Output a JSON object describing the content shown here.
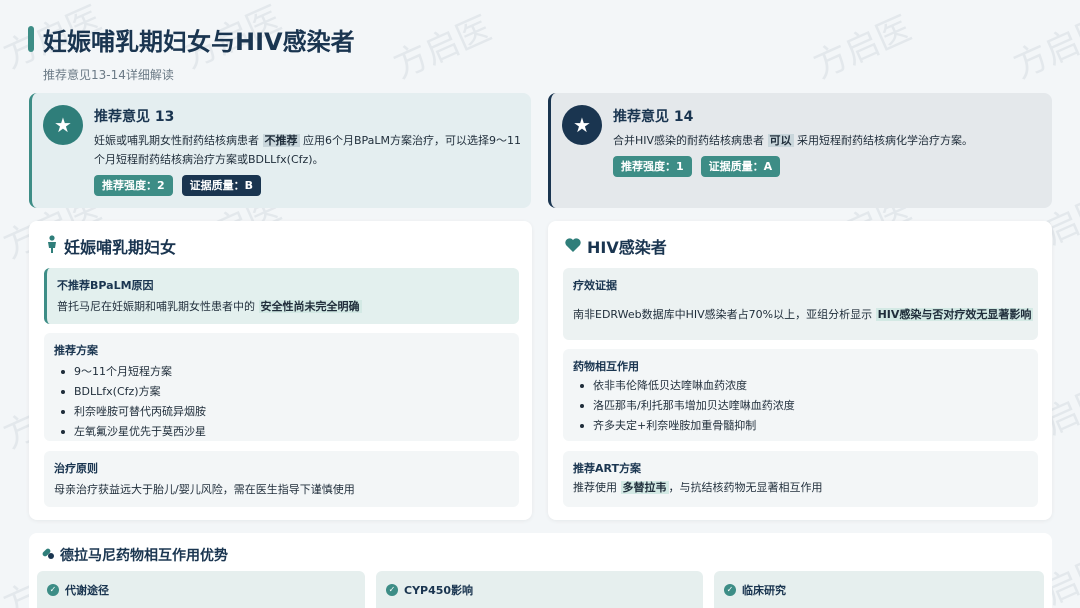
{
  "page": {
    "title": "妊娠哺乳期妇女与HIV感染者",
    "subtitle": "推荐意见13-14详细解读"
  },
  "rec13": {
    "icon": "star-icon",
    "title": "推荐意见 13",
    "text_a": "妊娠或哺乳期女性耐药结核病患者",
    "highlight": "不推荐",
    "text_b": "应用6个月BPaLM方案治疗，可以选择9～11",
    "text_c": "个月短程耐药结核病治疗方案或BDLLfx(Cfz)。",
    "tag1": "推荐强度：2",
    "tag2": "证据质量：B"
  },
  "rec14": {
    "icon": "star-icon",
    "title": "推荐意见 14",
    "text_a": "合并HIV感染的耐药结核病患者",
    "highlight": "可以",
    "text_b": "采用短程耐药结核病化学治疗方案。",
    "tag1": "推荐强度：1",
    "tag2": "证据质量：A"
  },
  "left_card": {
    "icon": "person-icon",
    "title": "妊娠哺乳期妇女",
    "reason": {
      "title": "不推荐BPaLM原因",
      "text": "普托马尼在妊娠期和哺乳期女性患者中的",
      "highlight": "安全性尚未完全明确"
    },
    "plan": {
      "title": "推荐方案",
      "items": [
        "9～11个月短程方案",
        "BDLLfx(Cfz)方案",
        "利奈唑胺可替代丙硫异烟胺",
        "左氧氟沙星优先于莫西沙星"
      ]
    },
    "principle": {
      "title": "治疗原则",
      "text": "母亲治疗获益远大于胎儿/婴儿风险，需在医生指导下谨慎使用"
    }
  },
  "right_card": {
    "icon": "heart-icon",
    "title": "HIV感染者",
    "evidence": {
      "title": "疗效证据",
      "text": "南非EDRWeb数据库中HIV感染者占70%以上，亚组分析显示",
      "highlight": "HIV感染与否对疗效无显著影响"
    },
    "interaction": {
      "title": "药物相互作用",
      "items": [
        "依非韦伦降低贝达喹啉血药浓度",
        "洛匹那韦/利托那韦增加贝达喹啉血药浓度",
        "齐多夫定+利奈唑胺加重骨髓抑制"
      ]
    },
    "art": {
      "title": "推荐ART方案",
      "text_a": "推荐使用",
      "highlight": "多替拉韦",
      "text_b": "，与抗结核药物无显著相互作用"
    }
  },
  "bottom": {
    "icon": "pills-icon",
    "title": "德拉马尼药物相互作用优势",
    "cards": [
      {
        "title": "代谢途径"
      },
      {
        "title": "CYP450影响"
      },
      {
        "title": "临床研究"
      }
    ]
  },
  "watermark": "方启医",
  "colors": {
    "teal": "#3d8d86",
    "navy": "#1a3550",
    "background": "#f3f6f8"
  }
}
